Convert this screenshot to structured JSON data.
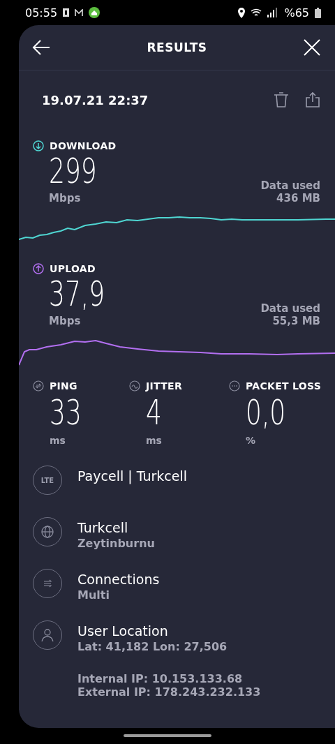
{
  "status_bar": {
    "time": "05:55",
    "battery": "%65"
  },
  "header": {
    "title": "RESULTS"
  },
  "result": {
    "timestamp": "19.07.21 22:37"
  },
  "speeds": [
    {
      "kind": "download",
      "label": "DOWNLOAD",
      "value": "299",
      "unit": "Mbps",
      "data_label": "Data used",
      "data_value": "436 MB",
      "color": "#4fd6d2"
    },
    {
      "kind": "upload",
      "label": "UPLOAD",
      "value": "37,9",
      "unit": "Mbps",
      "data_label": "Data used",
      "data_value": "55,3 MB",
      "color": "#b26ff0"
    }
  ],
  "stats": [
    {
      "kind": "ping",
      "label": "PING",
      "value": "33",
      "unit": "ms"
    },
    {
      "kind": "jitter",
      "label": "JITTER",
      "value": "4",
      "unit": "ms"
    },
    {
      "kind": "loss",
      "label": "PACKET LOSS",
      "value": "0,0",
      "unit": "%"
    }
  ],
  "info": [
    {
      "kind": "lte",
      "badge": "LTE",
      "title": "Paycell | Turkcell"
    },
    {
      "kind": "server",
      "title": "Turkcell",
      "subtitle": "Zeytinburnu"
    },
    {
      "kind": "connections",
      "title": "Connections",
      "subtitle": "Multi"
    },
    {
      "kind": "location",
      "title": "User Location",
      "subtitle": "Lat: 41,182 Lon: 27,506"
    }
  ],
  "ip": [
    "Internal IP: 10.153.133.68",
    "External IP: 178.243.232.133"
  ]
}
